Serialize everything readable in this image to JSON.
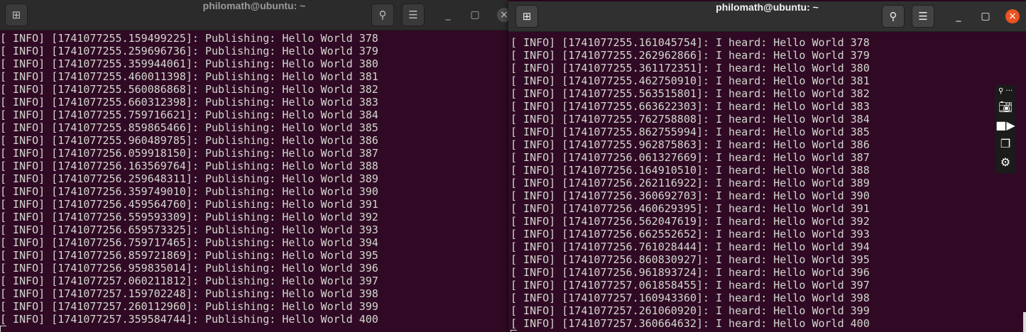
{
  "left_terminal": {
    "title": "philomath@ubuntu: ~",
    "lines": [
      "[ INFO] [1741077255.159499225]: Publishing: Hello World 378",
      "[ INFO] [1741077255.259696736]: Publishing: Hello World 379",
      "[ INFO] [1741077255.359944061]: Publishing: Hello World 380",
      "[ INFO] [1741077255.460011398]: Publishing: Hello World 381",
      "[ INFO] [1741077255.560086868]: Publishing: Hello World 382",
      "[ INFO] [1741077255.660312398]: Publishing: Hello World 383",
      "[ INFO] [1741077255.759716621]: Publishing: Hello World 384",
      "[ INFO] [1741077255.859865466]: Publishing: Hello World 385",
      "[ INFO] [1741077255.960489785]: Publishing: Hello World 386",
      "[ INFO] [1741077256.059918150]: Publishing: Hello World 387",
      "[ INFO] [1741077256.163569764]: Publishing: Hello World 388",
      "[ INFO] [1741077256.259648311]: Publishing: Hello World 389",
      "[ INFO] [1741077256.359749010]: Publishing: Hello World 390",
      "[ INFO] [1741077256.459564760]: Publishing: Hello World 391",
      "[ INFO] [1741077256.559593309]: Publishing: Hello World 392",
      "[ INFO] [1741077256.659573325]: Publishing: Hello World 393",
      "[ INFO] [1741077256.759717465]: Publishing: Hello World 394",
      "[ INFO] [1741077256.859721869]: Publishing: Hello World 395",
      "[ INFO] [1741077256.959835014]: Publishing: Hello World 396",
      "[ INFO] [1741077257.060211812]: Publishing: Hello World 397",
      "[ INFO] [1741077257.159702248]: Publishing: Hello World 398",
      "[ INFO] [1741077257.260112960]: Publishing: Hello World 399",
      "[ INFO] [1741077257.359584744]: Publishing: Hello World 400"
    ]
  },
  "right_terminal": {
    "title": "philomath@ubuntu: ~",
    "lines": [
      "[ INFO] [1741077255.161045754]: I heard: Hello World 378",
      "[ INFO] [1741077255.262962866]: I heard: Hello World 379",
      "[ INFO] [1741077255.361172351]: I heard: Hello World 380",
      "[ INFO] [1741077255.462750910]: I heard: Hello World 381",
      "[ INFO] [1741077255.563515801]: I heard: Hello World 382",
      "[ INFO] [1741077255.663622303]: I heard: Hello World 383",
      "[ INFO] [1741077255.762758808]: I heard: Hello World 384",
      "[ INFO] [1741077255.862755994]: I heard: Hello World 385",
      "[ INFO] [1741077255.962875863]: I heard: Hello World 386",
      "[ INFO] [1741077256.061327669]: I heard: Hello World 387",
      "[ INFO] [1741077256.164910510]: I heard: Hello World 388",
      "[ INFO] [1741077256.262116922]: I heard: Hello World 389",
      "[ INFO] [1741077256.360692703]: I heard: Hello World 390",
      "[ INFO] [1741077256.460629395]: I heard: Hello World 391",
      "[ INFO] [1741077256.562047619]: I heard: Hello World 392",
      "[ INFO] [1741077256.662552652]: I heard: Hello World 393",
      "[ INFO] [1741077256.761028444]: I heard: Hello World 394",
      "[ INFO] [1741077256.860830927]: I heard: Hello World 395",
      "[ INFO] [1741077256.961893724]: I heard: Hello World 396",
      "[ INFO] [1741077257.061858455]: I heard: Hello World 397",
      "[ INFO] [1741077257.160943360]: I heard: Hello World 398",
      "[ INFO] [1741077257.261060920]: I heard: Hello World 399",
      "[ INFO] [1741077257.360664632]: I heard: Hello World 400"
    ]
  },
  "icons": {
    "new_tab": "⊞",
    "search": "⚲",
    "menu": "☰",
    "minimize": "_",
    "maximize": "▢",
    "close": "×"
  },
  "colors": {
    "terminal_bg": "#300a24",
    "close_active": "#e95420"
  },
  "screenshot_toolbar": [
    "pin-icon",
    "camera-icon",
    "video-icon",
    "copy-icon",
    "gear-icon"
  ]
}
